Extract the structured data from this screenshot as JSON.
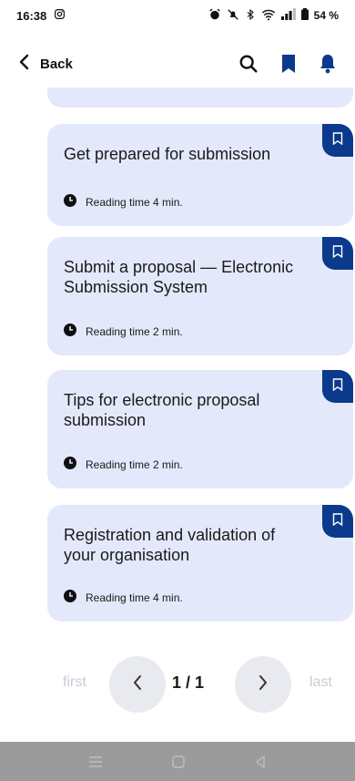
{
  "status_bar": {
    "time": "16:38",
    "battery": "54 %"
  },
  "header": {
    "back_label": "Back"
  },
  "articles": [
    {
      "title": "Get prepared for submission",
      "reading_time": "Reading time 4 min."
    },
    {
      "title": "Submit a proposal — Electronic Submission System",
      "reading_time": "Reading time 2 min."
    },
    {
      "title": "Tips for electronic proposal submission",
      "reading_time": "Reading time 2 min."
    },
    {
      "title": "Registration and validation of your organisation",
      "reading_time": "Reading time 4 min."
    }
  ],
  "pagination": {
    "first_label": "first",
    "last_label": "last",
    "page_indicator": "1 / 1"
  },
  "colors": {
    "card_bg": "#e4e8fb",
    "accent": "#0b3a8c",
    "nav_bar": "#9b9b9b"
  }
}
